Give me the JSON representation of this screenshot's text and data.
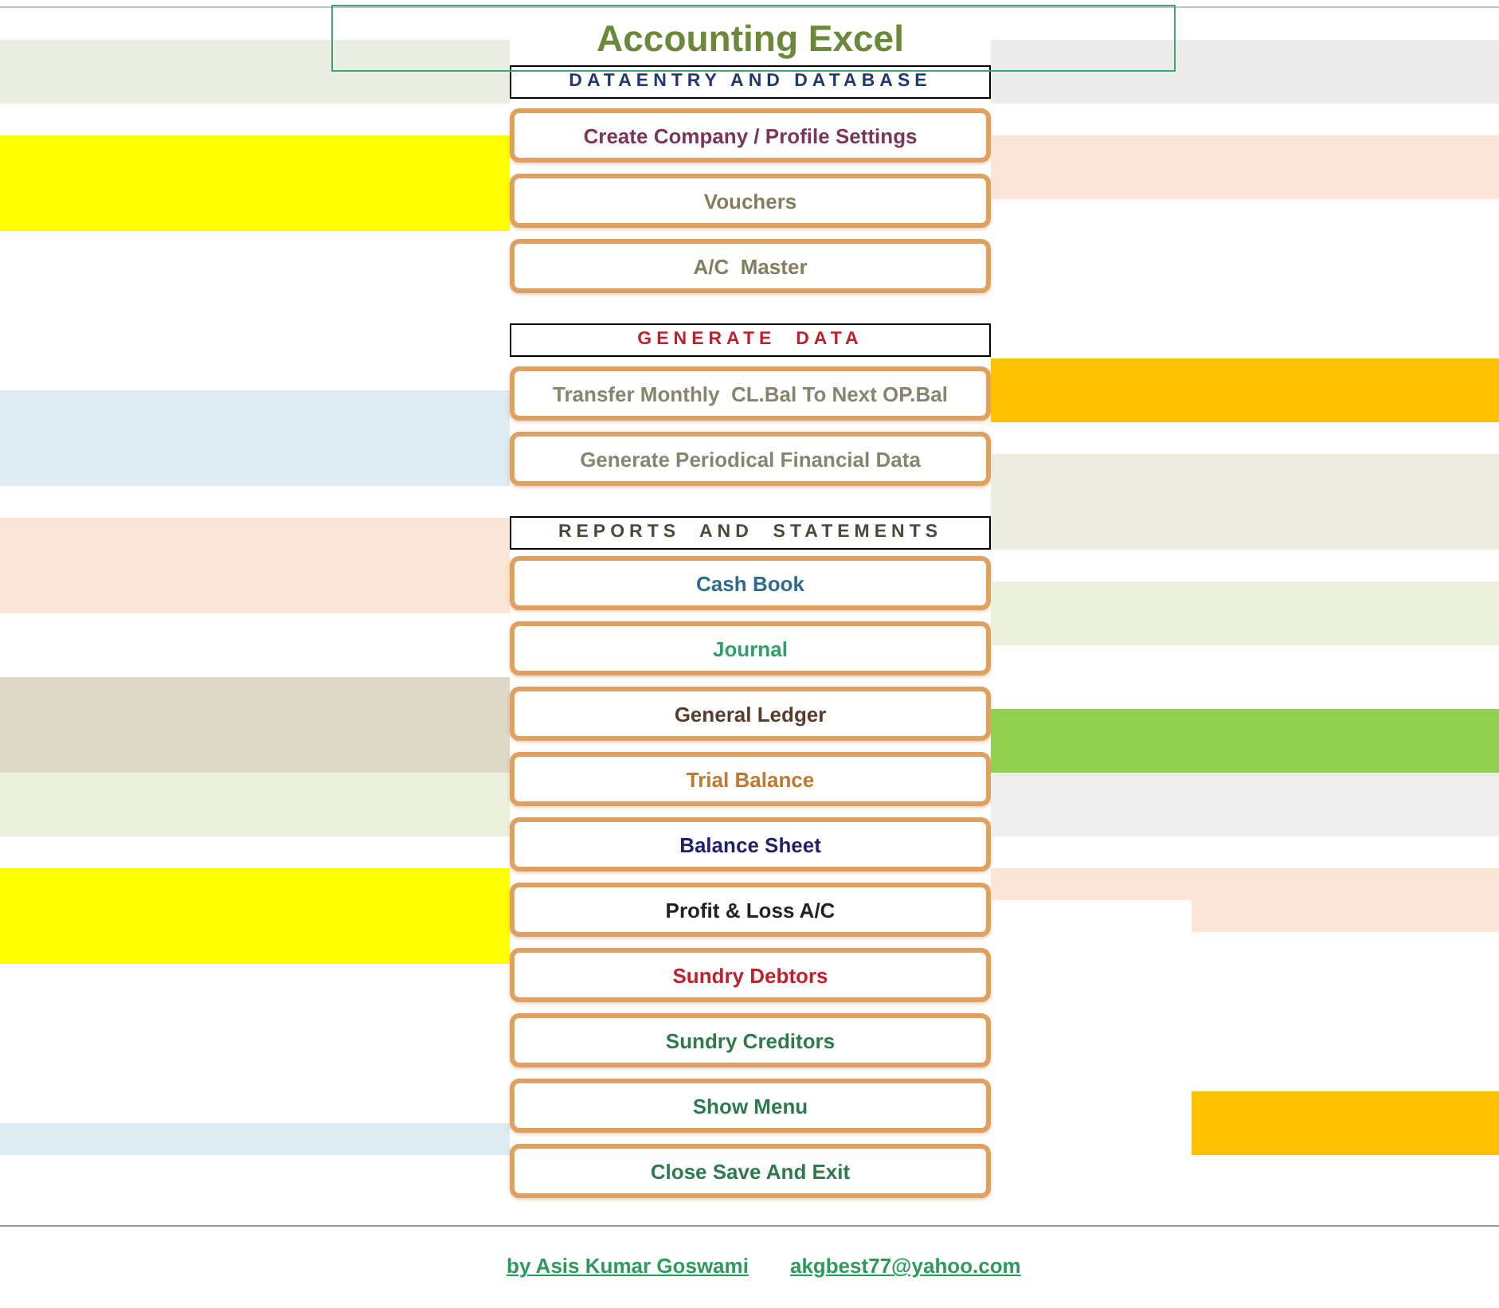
{
  "title": "Accounting Excel",
  "sections": [
    {
      "heading": "DATAENTRY AND DATABASE",
      "color": "#1f3870",
      "buttons": [
        {
          "label": "Create Company / Profile Settings",
          "color": "#7a3558"
        },
        {
          "label": "Vouchers",
          "color": "#80805e"
        },
        {
          "label": "A/C  Master",
          "color": "#80805e"
        }
      ]
    },
    {
      "heading": "GENERATE  DATA",
      "color": "#c0202c",
      "buttons": [
        {
          "label": "Transfer Monthly  CL.Bal To Next OP.Bal",
          "color": "#86866e"
        },
        {
          "label": "Generate Periodical Financial Data",
          "color": "#86866e"
        }
      ]
    },
    {
      "heading": "REPORTS  AND  STATEMENTS",
      "color": "#4a4a3a",
      "buttons": [
        {
          "label": "Cash Book",
          "color": "#2e6b8f"
        },
        {
          "label": "Journal",
          "color": "#2ea06a"
        },
        {
          "label": "General Ledger",
          "color": "#5a3a2a"
        },
        {
          "label": "Trial Balance",
          "color": "#c07830"
        },
        {
          "label": "Balance Sheet",
          "color": "#1f1f6f"
        },
        {
          "label": "Profit & Loss A/C",
          "color": "#222222"
        },
        {
          "label": "Sundry Debtors",
          "color": "#c0202c"
        },
        {
          "label": "Sundry Creditors",
          "color": "#2e7a4a"
        },
        {
          "label": "Show Menu",
          "color": "#2e7a50"
        },
        {
          "label": "Close Save And Exit",
          "color": "#2e7a50"
        }
      ]
    }
  ],
  "footer": {
    "author": "by Asis Kumar Goswami",
    "email": "akgbest77@yahoo.com"
  }
}
